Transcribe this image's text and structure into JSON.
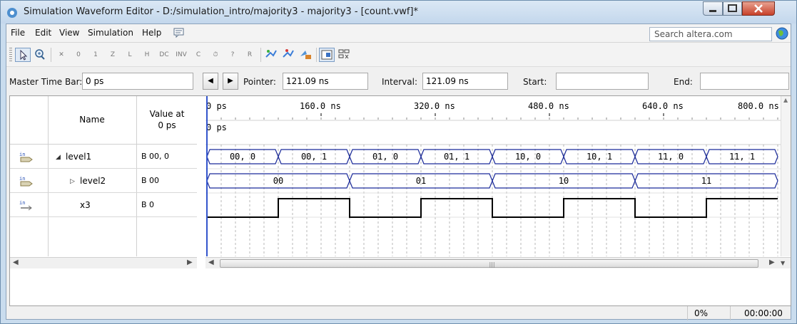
{
  "window": {
    "title": "Simulation Waveform Editor - D:/simulation_intro/majority3 - majority3 - [count.vwf]*"
  },
  "menu": {
    "items": [
      "File",
      "Edit",
      "View",
      "Simulation",
      "Help"
    ],
    "search_placeholder": "Search altera.com"
  },
  "toolbar": {
    "icons": [
      "selection-tool-icon",
      "zoom-tool-icon",
      "force-unknown-icon",
      "force-low-icon",
      "force-high-icon",
      "force-high-impedance-icon",
      "force-weak-low-icon",
      "force-weak-high-icon",
      "force-dont-care-icon",
      "invert-icon",
      "count-value-icon",
      "clock-value-icon",
      "arbitrary-value-icon",
      "random-value-icon",
      "run-functional-simulation-icon",
      "run-timing-simulation-icon",
      "generate-netlist-icon",
      "snap-to-grid-icon",
      "sort-icon"
    ]
  },
  "timebar": {
    "master_label": "Master Time Bar:",
    "master_value": "0 ps",
    "pointer_label": "Pointer:",
    "pointer_value": "121.09 ns",
    "interval_label": "Interval:",
    "interval_value": "121.09 ns",
    "start_label": "Start:",
    "start_value": "",
    "end_label": "End:",
    "end_value": ""
  },
  "grid": {
    "header_name": "Name",
    "header_value_line1": "Value at",
    "header_value_line2": "0 ps",
    "ruler_labels": [
      "0 ps",
      "160.0 ns",
      "320.0 ns",
      "480.0 ns",
      "640.0 ns",
      "800.0 ns"
    ],
    "marker_label": "0 ps",
    "signals": [
      {
        "name": "level1",
        "value": "B 00, 0",
        "type": "input",
        "expander": "expanded",
        "indent": 0
      },
      {
        "name": "level2",
        "value": "B 00",
        "type": "input",
        "expander": "collapsed",
        "indent": 1
      },
      {
        "name": "x3",
        "value": "B 0",
        "type": "input",
        "expander": "none",
        "indent": 1
      }
    ],
    "bus_level1": [
      "00, 0",
      "00, 1",
      "01, 0",
      "01, 1",
      "10, 0",
      "10, 1",
      "11, 0",
      "11, 1"
    ],
    "bus_level2": [
      "00",
      "01",
      "10",
      "11"
    ],
    "x3_bits": [
      0,
      1,
      0,
      1,
      0,
      1,
      0,
      1
    ]
  },
  "status": {
    "percent": "0%",
    "elapsed": "00:00:00"
  },
  "colors": {
    "bus_line": "#1a2a9a",
    "vertical_marker": "#3355cc",
    "titlebar": "#c9dcee"
  }
}
